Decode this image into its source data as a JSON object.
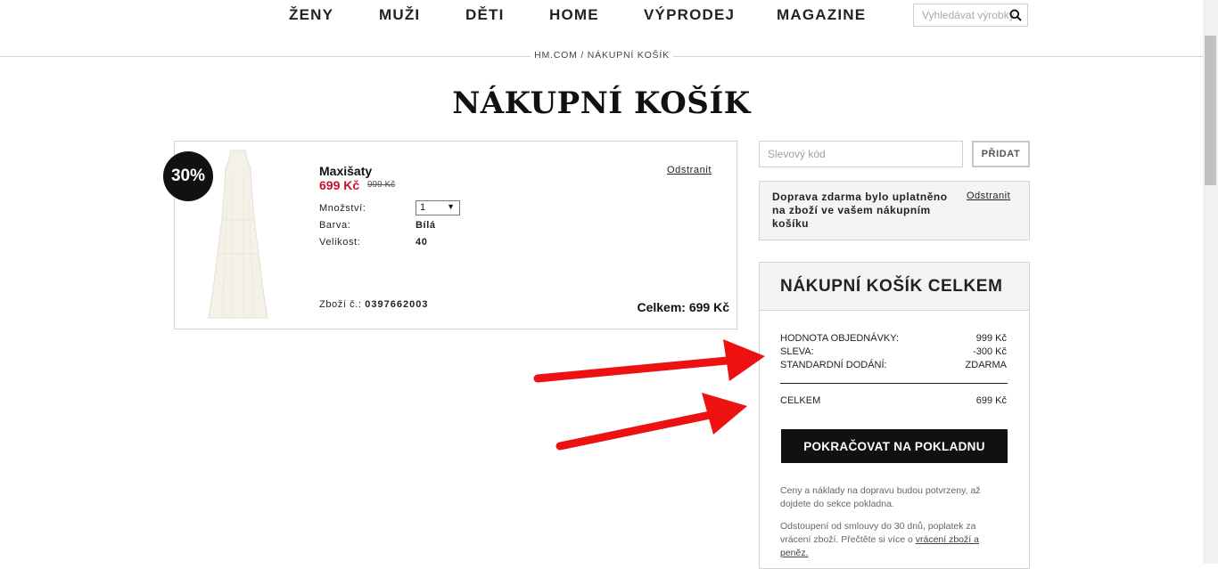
{
  "nav": {
    "items": [
      {
        "label": "ŽENY"
      },
      {
        "label": "MUŽI"
      },
      {
        "label": "DĚTI"
      },
      {
        "label": "HOME"
      },
      {
        "label": "VÝPRODEJ"
      },
      {
        "label": "MAGAZINE"
      }
    ],
    "search_placeholder": "Vyhledávat výrobky"
  },
  "breadcrumb": "HM.COM / NÁKUPNÍ KOŠÍK",
  "page_title": "NÁKUPNÍ KOŠÍK",
  "product": {
    "badge": "30%",
    "name": "Maxišaty",
    "price": "699 Kč",
    "old_price": "999 Kč",
    "remove": "Odstranit",
    "quantity_label": "Množství:",
    "quantity_value": "1",
    "color_label": "Barva:",
    "color_value": "Bílá",
    "size_label": "Velikost:",
    "size_value": "40",
    "article_label": "Zboží č.:",
    "article_number": "0397662003",
    "total": "Celkem: 699 Kč"
  },
  "promo": {
    "placeholder": "Slevový kód",
    "add_label": "PŘIDAT"
  },
  "shipping_notice": {
    "text": "Doprava zdarma bylo uplatněno na zboží ve vašem nákupním košíku",
    "remove": "Odstranit"
  },
  "summary": {
    "title": "NÁKUPNÍ KOŠÍK CELKEM",
    "rows": [
      {
        "label": "HODNOTA OBJEDNÁVKY:",
        "value": "999 Kč"
      },
      {
        "label": "SLEVA:",
        "value": "-300 Kč"
      },
      {
        "label": "STANDARDNÍ DODÁNÍ:",
        "value": "ZDARMA"
      }
    ],
    "total_label": "CELKEM",
    "total_value": "699 Kč",
    "checkout_label": "POKRAČOVAT NA POKLADNU",
    "note1": "Ceny a náklady na dopravu budou potvrzeny, až dojdete do sekce pokladna.",
    "note2_text": "Odstoupení od smlouvy do 30 dnů, poplatek za vrácení zboží. Přečtěte si více o ",
    "note2_link": "vrácení zboží a peněz."
  },
  "colors": {
    "sale_red": "#c8102e",
    "annotation_arrow": "#ee1111",
    "button_black": "#111111"
  }
}
